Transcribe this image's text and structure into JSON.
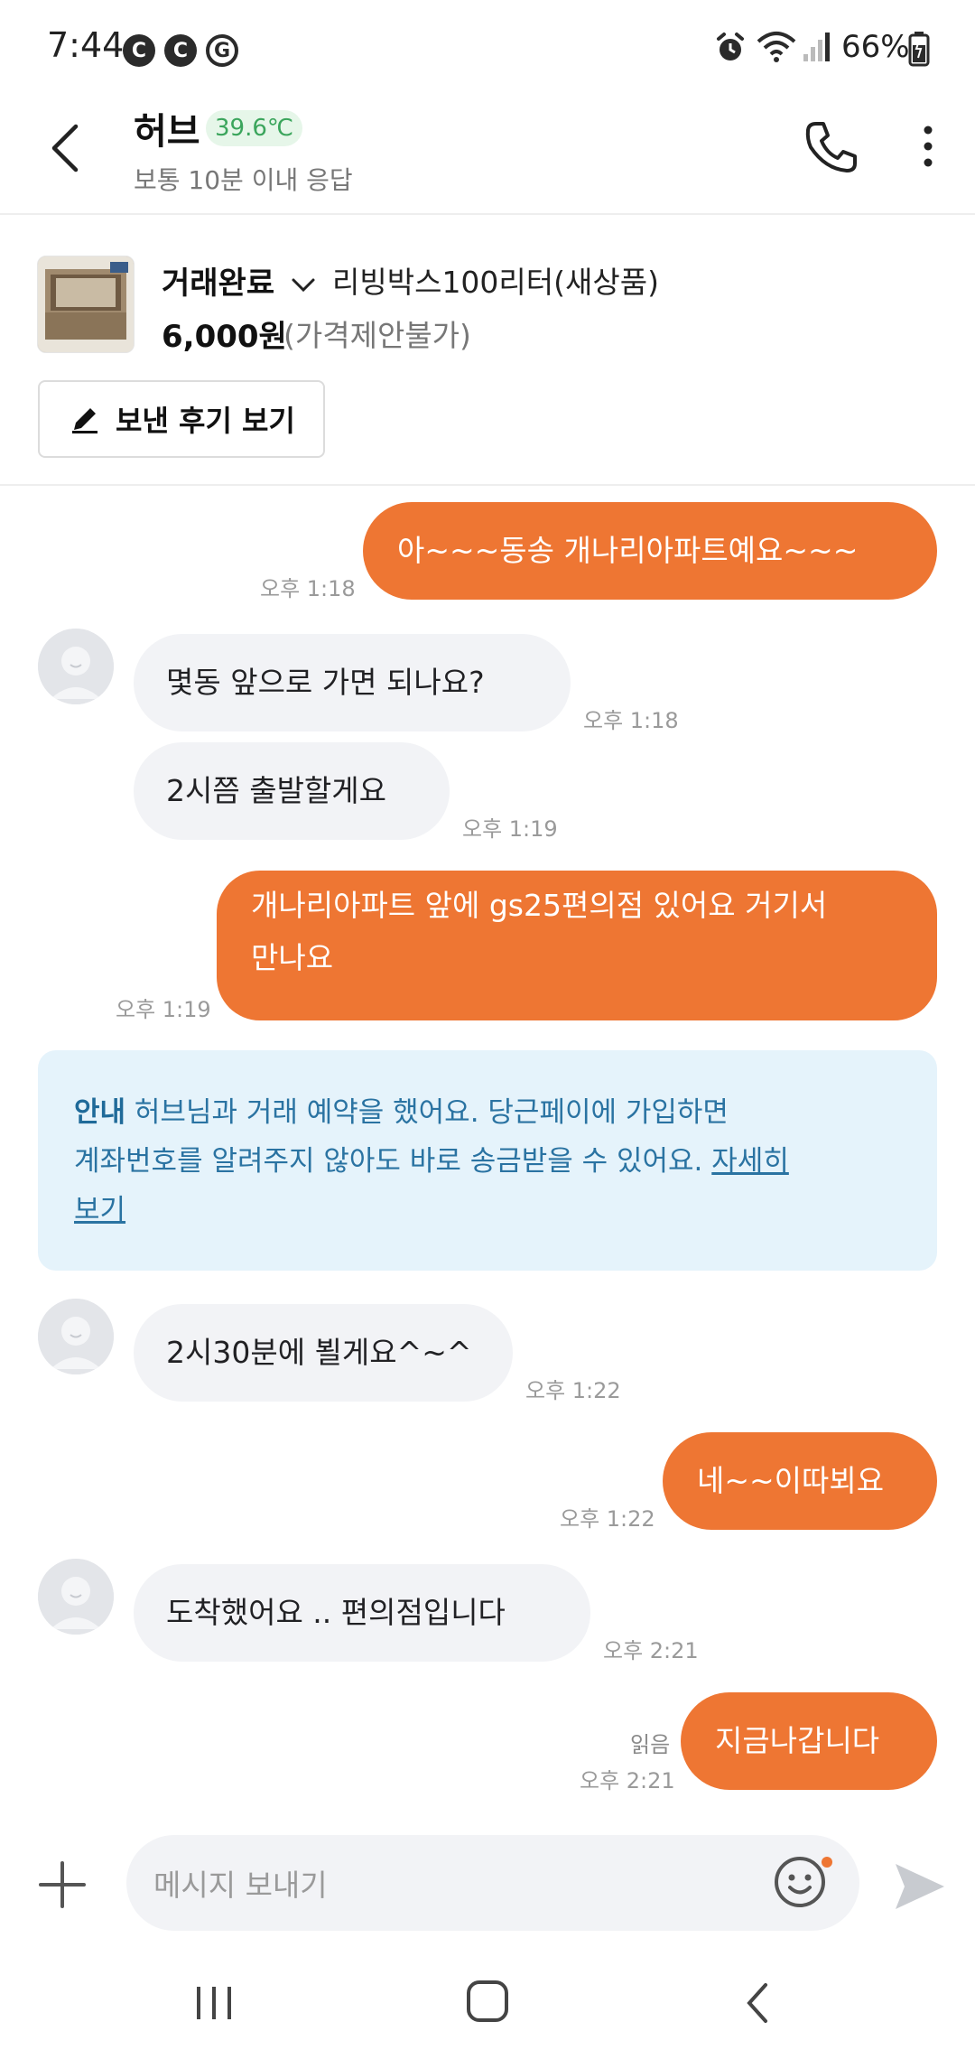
{
  "status_bar": {
    "time": "7:44",
    "notif_icons": [
      "C",
      "C",
      "G"
    ],
    "battery": "66%"
  },
  "header": {
    "name": "허브",
    "temperature": "39.6℃",
    "subtitle": "보통 10분 이내 응답"
  },
  "product": {
    "status": "거래완료",
    "title": "리빙박스100리터(새상품)",
    "price": "6,000원",
    "price_note": "(가격제안불가)",
    "review_button": "보낸 후기 보기"
  },
  "messages": [
    {
      "sender": "me",
      "text": "아~~~동송 개나리아파트예요~~~",
      "time": "오후 1:18"
    },
    {
      "sender": "them",
      "text": "몇동 앞으로 가면  되나요?",
      "time": "오후 1:18"
    },
    {
      "sender": "them",
      "text": "2시쯤 출발할게요",
      "time": "오후 1:19"
    },
    {
      "sender": "me",
      "text_line1": "개나리아파트 앞에 gs25편의점 있어요 거기서",
      "text_line2": "만나요",
      "time": "오후 1:19"
    },
    {
      "sender": "them",
      "text": "2시30분에 뵐게요^~^",
      "time": "오후 1:22"
    },
    {
      "sender": "me",
      "text": "네~~이따뵈요",
      "time": "오후 1:22"
    },
    {
      "sender": "them",
      "text": "도착했어요  .. 편의점입니다",
      "time": "오후 2:21"
    },
    {
      "sender": "me",
      "text": "지금나갑니다",
      "time": "오후 2:21",
      "read": "읽음"
    }
  ],
  "notice": {
    "title": "안내",
    "body_line1": " 허브님과 거래 예약을 했어요. 당근페이에 가입하면",
    "body_line2": "계좌번호를 알려주지 않아도 바로 송금받을 수 있어요. ",
    "link_part1": "자세히",
    "link_part2": "보기"
  },
  "input": {
    "placeholder": "메시지 보내기"
  },
  "colors": {
    "accent": "#ee7633",
    "temp_green": "#3ba55c",
    "notice_bg": "#e5f3fb",
    "notice_text": "#2a73a2"
  },
  "icons": [
    "back-icon",
    "phone-icon",
    "more-icon",
    "pencil-icon",
    "plus-icon",
    "emoji-icon",
    "send-icon",
    "recent-apps-icon",
    "home-icon",
    "nav-back-icon",
    "alarm-icon",
    "wifi-icon",
    "signal-icon",
    "battery-icon"
  ]
}
